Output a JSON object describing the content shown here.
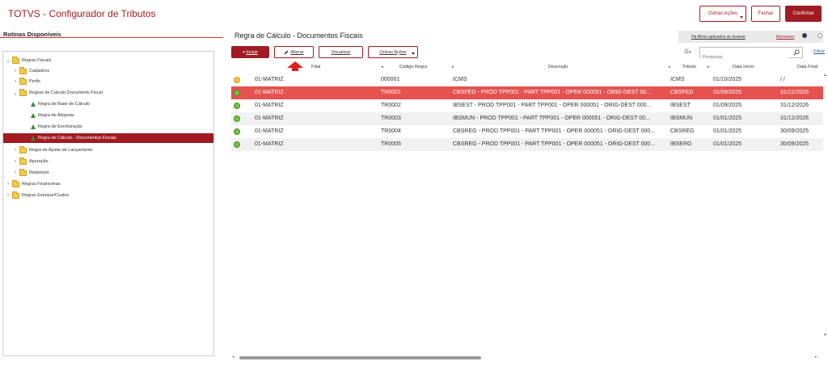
{
  "header": {
    "app_title": "TOTVS - Configurador de Tributos",
    "other_actions": "Outras Ações",
    "close": "Fechar",
    "confirm": "Confirmar"
  },
  "left": {
    "title": "Rotinas Disponíveis",
    "tree": [
      {
        "label": "Regras Fiscais",
        "type": "folder",
        "expanded": true
      },
      {
        "label": "Cadastros",
        "type": "folder",
        "expanded": false
      },
      {
        "label": "Perfis",
        "type": "folder",
        "expanded": false
      },
      {
        "label": "Regras de Calculo Documento Fiscal",
        "type": "folder",
        "expanded": true
      },
      {
        "label": "Regra de Base de Cálculo",
        "type": "item"
      },
      {
        "label": "Regra de Alíquota",
        "type": "item"
      },
      {
        "label": "Regra de Escrituração",
        "type": "item"
      },
      {
        "label": "Regra de Cálculo - Documentos Fiscais",
        "type": "item",
        "selected": true
      },
      {
        "label": "Regra de Ajuste de Lançamento",
        "type": "folder",
        "expanded": false
      },
      {
        "label": "Apuração",
        "type": "folder",
        "expanded": false
      },
      {
        "label": "Relatórios",
        "type": "folder",
        "expanded": false
      },
      {
        "label": "Regras Financeiras",
        "type": "folder",
        "expanded": false
      },
      {
        "label": "Regras Estoque/Custos",
        "type": "folder",
        "expanded": false
      }
    ]
  },
  "main": {
    "title": "Regra de Cálculo - Documentos Fiscais",
    "filter_note": "Há filtros aplicados ao browse",
    "remove": "Remover",
    "toolbar": {
      "include": "Incluir",
      "edit": "Alterar",
      "view": "Visualizar",
      "other_actions": "Outras Ações"
    },
    "search_placeholder": "Pesquisar",
    "filter": "Filtrar",
    "columns": [
      "Filial",
      "Código Regra",
      "Descrição",
      "Tributo",
      "Data Início",
      "Data Final"
    ],
    "rows": [
      {
        "status": "yellow",
        "filial": "01-MATRIZ",
        "codigo": "000001",
        "descricao": "ICMS",
        "tributo": "ICMS",
        "inicio": "01/10/2025",
        "final": "/ /"
      },
      {
        "status": "green",
        "filial": "01-MATRIZ",
        "codigo": "TR0001",
        "descricao": "CBSFED - PROD TPP001 - PART TPP001 - OPER 000051 - ORIG-DEST 00...",
        "tributo": "CBSFED",
        "inicio": "01/09/2025",
        "final": "31/12/2026",
        "selected": true
      },
      {
        "status": "green",
        "filial": "01-MATRIZ",
        "codigo": "TR0002",
        "descricao": "IBSEST - PROD TPP001 - PART TPP001 - OPER 000051 - ORIG-DEST 000...",
        "tributo": "IBSEST",
        "inicio": "01/09/2025",
        "final": "31/12/2026"
      },
      {
        "status": "green",
        "filial": "01-MATRIZ",
        "codigo": "TR0003",
        "descricao": "IBSMUN - PROD TPP001 - PART TPP001 - OPER 000051 - ORIG-DEST 00...",
        "tributo": "IBSMUN",
        "inicio": "01/01/2025",
        "final": "31/12/2026"
      },
      {
        "status": "green",
        "filial": "01-MATRIZ",
        "codigo": "TR0004",
        "descricao": "CBSREG - PROD TPP001 - PART TPP001 - OPER 000051 - ORIG-DEST 000...",
        "tributo": "CBSREG",
        "inicio": "01/01/2025",
        "final": "30/09/2025"
      },
      {
        "status": "green",
        "filial": "01-MATRIZ",
        "codigo": "TR0005",
        "descricao": "CBSREG - PROD TPP001 - PART TPP001 - OPER 000051 - ORIG-DEST 000...",
        "tributo": "IBSERG",
        "inicio": "01/01/2025",
        "final": "30/09/2025"
      }
    ]
  },
  "colors": {
    "brand": "#a01c22",
    "selected_row": "#e5524f",
    "status_green": "#7bc043",
    "status_yellow": "#f5c542"
  },
  "icons": [
    "folder-icon",
    "rule-triangle-icon",
    "search-icon",
    "columns-icon",
    "pencil-icon",
    "plus-icon",
    "arrow-up-icon"
  ]
}
